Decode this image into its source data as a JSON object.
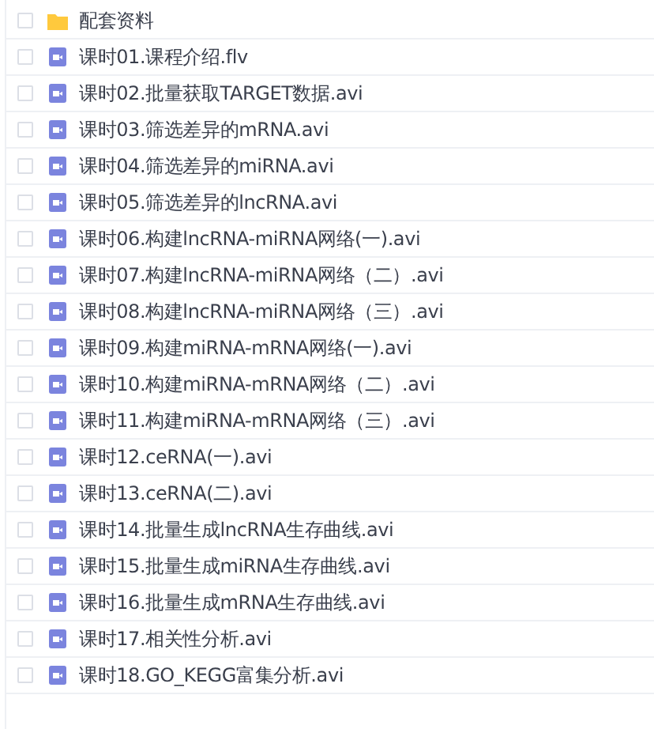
{
  "files": [
    {
      "kind": "folder",
      "name": "配套资料",
      "checked": false
    },
    {
      "kind": "video",
      "name": "课时01.课程介绍.flv",
      "checked": false
    },
    {
      "kind": "video",
      "name": "课时02.批量获取TARGET数据.avi",
      "checked": false
    },
    {
      "kind": "video",
      "name": "课时03.筛选差异的mRNA.avi",
      "checked": false
    },
    {
      "kind": "video",
      "name": "课时04.筛选差异的miRNA.avi",
      "checked": false
    },
    {
      "kind": "video",
      "name": "课时05.筛选差异的lncRNA.avi",
      "checked": false
    },
    {
      "kind": "video",
      "name": "课时06.构建lncRNA-miRNA网络(一).avi",
      "checked": false
    },
    {
      "kind": "video",
      "name": "课时07.构建lncRNA-miRNA网络（二）.avi",
      "checked": false
    },
    {
      "kind": "video",
      "name": "课时08.构建lncRNA-miRNA网络（三）.avi",
      "checked": false
    },
    {
      "kind": "video",
      "name": "课时09.构建miRNA-mRNA网络(一).avi",
      "checked": false
    },
    {
      "kind": "video",
      "name": "课时10.构建miRNA-mRNA网络（二）.avi",
      "checked": false
    },
    {
      "kind": "video",
      "name": "课时11.构建miRNA-mRNA网络（三）.avi",
      "checked": false
    },
    {
      "kind": "video",
      "name": "课时12.ceRNA(一).avi",
      "checked": false
    },
    {
      "kind": "video",
      "name": "课时13.ceRNA(二).avi",
      "checked": false
    },
    {
      "kind": "video",
      "name": "课时14.批量生成lncRNA生存曲线.avi",
      "checked": false
    },
    {
      "kind": "video",
      "name": "课时15.批量生成miRNA生存曲线.avi",
      "checked": false
    },
    {
      "kind": "video",
      "name": "课时16.批量生成mRNA生存曲线.avi",
      "checked": false
    },
    {
      "kind": "video",
      "name": "课时17.相关性分析.avi",
      "checked": false
    },
    {
      "kind": "video",
      "name": "课时18.GO_KEGG富集分析.avi",
      "checked": false
    }
  ]
}
